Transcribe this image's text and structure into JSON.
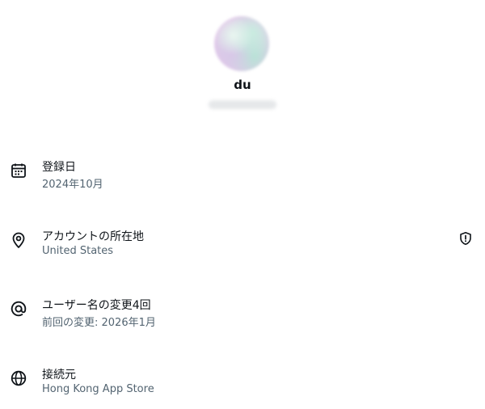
{
  "profile": {
    "name": "du"
  },
  "rows": [
    {
      "title": "登録日",
      "sub": "2024年10月",
      "icon": "calendar-icon"
    },
    {
      "title": "アカウントの所在地",
      "sub": "United States",
      "icon": "location-pin-icon",
      "right_icon": "shield-alert-icon"
    },
    {
      "title": "ユーザー名の変更4回",
      "sub": "前回の変更: 2026年1月",
      "icon": "at-sign-icon"
    },
    {
      "title": "接続元",
      "sub": "Hong Kong App Store",
      "icon": "globe-icon"
    }
  ]
}
